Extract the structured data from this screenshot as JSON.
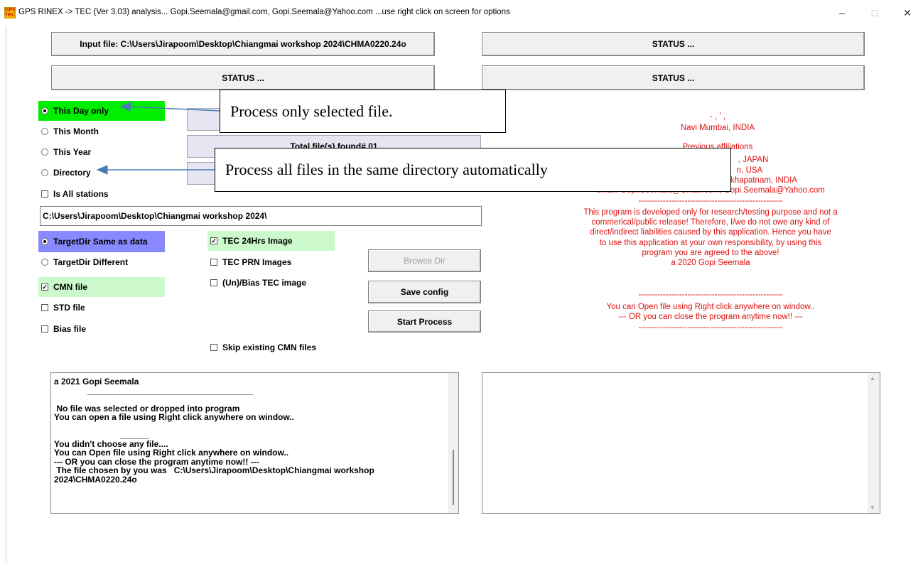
{
  "window": {
    "title": "GPS RINEX -> TEC (Ver 3.03) analysis...  Gopi.Seemala@gmail.com, Gopi.Seemala@Yahoo.com  ...use right click on screen for options",
    "icon_text": "GPS TEC",
    "controls": {
      "minimize": "–",
      "maximize": "□",
      "close": "✕"
    }
  },
  "top_buttons": {
    "input_file": "Input file: C:\\Users\\Jirapoom\\Desktop\\Chiangmai workshop 2024\\CHMA0220.24o",
    "status_top_right": "STATUS ...",
    "status_mid_left": "STATUS ...",
    "status_mid_right": "STATUS ..."
  },
  "scope_options": [
    {
      "label": "This Day only",
      "selected": true
    },
    {
      "label": "This Month",
      "selected": false
    },
    {
      "label": "This Year",
      "selected": false
    },
    {
      "label": "Directory",
      "selected": false
    }
  ],
  "is_all_stations": {
    "label": "Is All stations",
    "checked": false
  },
  "info_buttons": {
    "total_files": "Total file(s) found# 01"
  },
  "directory_path": "C:\\Users\\Jirapoom\\Desktop\\Chiangmai workshop 2024\\",
  "target_options": [
    {
      "label": "TargetDir Same as data",
      "selected": true
    },
    {
      "label": "TargetDir Different",
      "selected": false
    }
  ],
  "left_checks": [
    {
      "label": "CMN file",
      "checked": true
    },
    {
      "label": "STD file",
      "checked": false
    },
    {
      "label": "Bias file",
      "checked": false
    }
  ],
  "middle_checks": [
    {
      "label": "TEC 24Hrs Image",
      "checked": true
    },
    {
      "label": "TEC PRN Images",
      "checked": false
    },
    {
      "label": "(Un)/Bias TEC image",
      "checked": false
    }
  ],
  "skip_existing": {
    "label": "Skip existing CMN files",
    "checked": false
  },
  "action_buttons": {
    "browse_dir": "Browse Dir",
    "save_config": "Save config",
    "start_process": "Start Process"
  },
  "check_mark": "✓",
  "info_panel": {
    "lines_top": [
      "-      ,       '   ,",
      "Navi Mumbai, INDIA",
      "Previous affiliations",
      ", JAPAN",
      "n, USA",
      "khapatnam, INDIA",
      "email: Gopi.Seemala@Gmail.com, Gopi.Seemala@Yahoo.com",
      "-----------------------------------------------------"
    ],
    "disclaimer": [
      "This program is developed only for research/testing purpose and not a",
      "commerical/public release! Therefore, I/we do not owe any kind of",
      "direct/indirect liabilities caused by this application. Hence you have",
      "to use this application at your own responsibility, by using this",
      "program you are agreed to the above!",
      "a 2020 Gopi Seemala"
    ],
    "footer": [
      "-----------------------------------------------------",
      "You can Open file using Right click anywhere on window..",
      "--- OR you can close the program anytime now!! ---",
      "-----------------------------------------------------"
    ]
  },
  "log_text": "a 2021 Gopi Seemala\n              ___________________________________\n\n No file was selected or dropped into program\nYou can open a file using Right click anywhere on window..\n\n                            ______\nYou didn't choose any file....\nYou can Open file using Right click anywhere on window..\n--- OR you can close the program anytime now!! ---\n The file chosen by you was   C:\\Users\\Jirapoom\\Desktop\\Chiangmai workshop\n2024\\CHMA0220.24o",
  "right_log_text": "",
  "scrollbar_arrows": {
    "up": "▲",
    "down": "▼"
  },
  "annotations": {
    "callout_1": "Process only selected file.",
    "callout_2": "Process all files in the same directory automatically",
    "arrow_color": "#4a7ab8"
  }
}
